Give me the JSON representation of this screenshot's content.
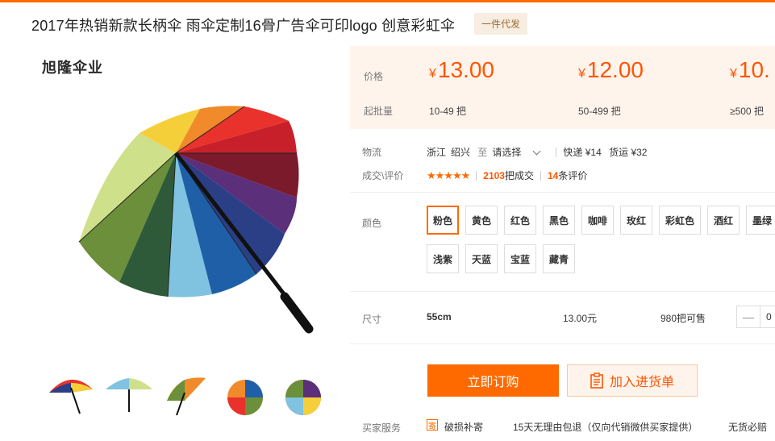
{
  "product": {
    "title": "2017年热销新款长柄伞 雨伞定制16骨广告伞可印logo 创意彩虹伞",
    "tag": "一件代发",
    "brand": "旭隆伞业"
  },
  "pricing": {
    "price_label": "价格",
    "moq_label": "起批量",
    "currency": "¥",
    "tiers": [
      {
        "price": "13.00",
        "range": "10-49 把"
      },
      {
        "price": "12.00",
        "range": "50-499 把"
      },
      {
        "price": "10.",
        "range": "≥500 把"
      }
    ]
  },
  "logistics": {
    "label": "物流",
    "origin_province": "浙江",
    "origin_city": "绍兴",
    "to": "至",
    "destination_placeholder": "请选择",
    "express": "快递 ¥14",
    "freight": "货运 ¥32"
  },
  "deals": {
    "label": "成交\\评价",
    "stars": "★★★★★",
    "count": "2103",
    "count_suffix": "把成交",
    "reviews": "14",
    "reviews_suffix": "条评价"
  },
  "colors": {
    "label": "颜色",
    "options": [
      "粉色",
      "黄色",
      "红色",
      "黑色",
      "咖啡",
      "玫红",
      "彩虹色",
      "酒红",
      "墨绿",
      "浅紫",
      "天蓝",
      "宝蓝",
      "藏青"
    ],
    "selected": "粉色"
  },
  "size": {
    "label": "尺寸",
    "value": "55cm",
    "price": "13.00元",
    "stock": "980把可售",
    "quantity": "0"
  },
  "actions": {
    "buy": "立即订购",
    "add_cart": "加入进货单"
  },
  "services": {
    "label": "买家服务",
    "icon_char": "寄",
    "items": [
      "破损补寄",
      "15天无理由包退（仅向代销微供买家提供）",
      "无货必赔"
    ]
  },
  "colors_theme": {
    "accent": "#ff6a00",
    "price": "#ff5500",
    "band": "#fff4ec"
  }
}
